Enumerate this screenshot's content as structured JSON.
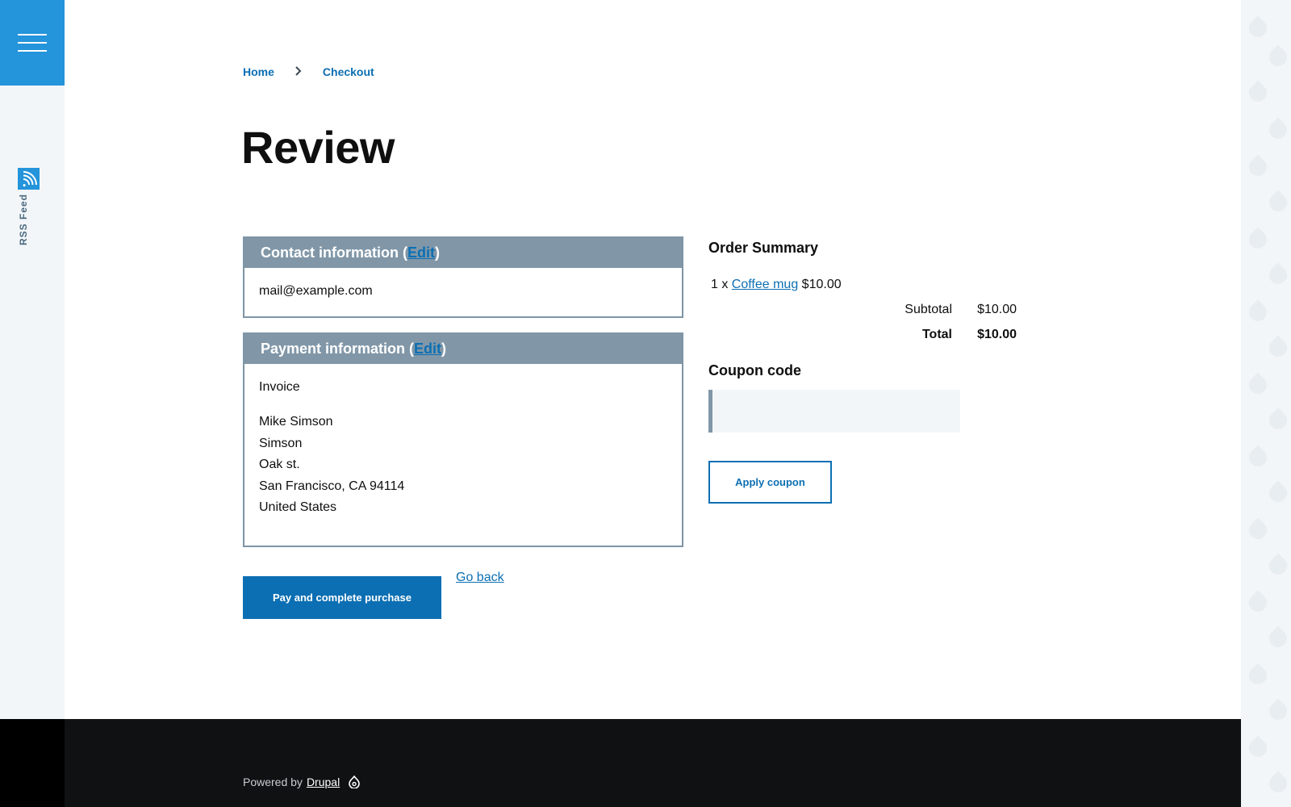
{
  "nav": {
    "menu_icon": "hamburger-icon",
    "rss_icon": "rss-icon",
    "rss_label": "RSS Feed"
  },
  "breadcrumb": {
    "items": [
      {
        "label": "Home"
      },
      {
        "label": "Checkout"
      }
    ],
    "separator_icon": "chevron-right-icon"
  },
  "page": {
    "title": "Review"
  },
  "contact": {
    "title": "Contact information (",
    "edit": "Edit",
    "close": ")",
    "email": "mail@example.com"
  },
  "payment": {
    "title": "Payment information (",
    "edit": "Edit",
    "close": ")",
    "method": "Invoice",
    "address": [
      "Mike Simson",
      "Simson",
      "Oak st.",
      "San Francisco, CA 94114",
      "United States"
    ]
  },
  "actions": {
    "pay": "Pay and complete purchase",
    "go_back": "Go back"
  },
  "order_summary": {
    "title": "Order Summary",
    "item_qty": "1 x",
    "item_name": "Coffee mug",
    "item_price": "$10.00",
    "subtotal_label": "Subtotal",
    "subtotal": "$10.00",
    "total_label": "Total",
    "total": "$10.00"
  },
  "coupon": {
    "title": "Coupon code",
    "value": "",
    "button": "Apply coupon"
  },
  "footer": {
    "powered_by": "Powered by",
    "link": "Drupal",
    "logo_icon": "drupal-drop-icon"
  },
  "colors": {
    "accent": "#2494db",
    "link": "#0c6fb3",
    "pane_header": "#8197a8",
    "footer_bg": "#0f1113"
  }
}
